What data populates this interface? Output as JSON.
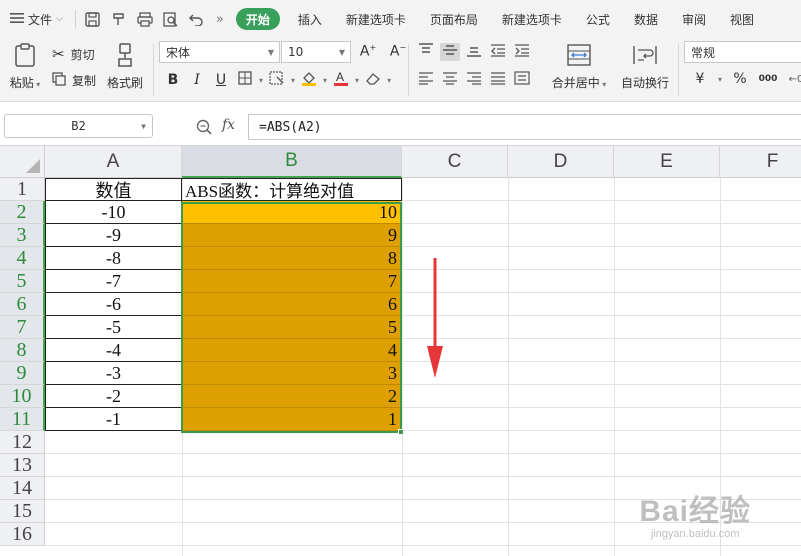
{
  "menubar": {
    "file_label": "文件",
    "tabs": [
      "开始",
      "插入",
      "新建选项卡",
      "页面布局",
      "新建选项卡",
      "公式",
      "数据",
      "审阅",
      "视图"
    ],
    "active_tab_index": 0
  },
  "ribbon": {
    "paste": "粘贴",
    "cut": "剪切",
    "copy": "复制",
    "format_painter": "格式刷",
    "font_name": "宋体",
    "font_size": "10",
    "merge_center": "合并居中",
    "wrap_text": "自动换行",
    "number_format": "常规",
    "currency_symbol": "¥",
    "percent_symbol": "%",
    "thousands_symbol": "000"
  },
  "formula_bar": {
    "cell_ref": "B2",
    "fx": "fx",
    "formula": "=ABS(A2)"
  },
  "sheet": {
    "columns": [
      "A",
      "B",
      "C",
      "D",
      "E",
      "F"
    ],
    "selected_column": "B",
    "row_numbers": [
      "1",
      "2",
      "3",
      "4",
      "5",
      "6",
      "7",
      "8",
      "9",
      "10",
      "11",
      "12",
      "13",
      "14",
      "15",
      "16"
    ],
    "header": {
      "a": "数值",
      "b": "ABS函数：计算绝对值"
    },
    "rows": [
      {
        "a": "-10",
        "b": "10"
      },
      {
        "a": "-9",
        "b": "9"
      },
      {
        "a": "-8",
        "b": "8"
      },
      {
        "a": "-7",
        "b": "7"
      },
      {
        "a": "-6",
        "b": "6"
      },
      {
        "a": "-5",
        "b": "5"
      },
      {
        "a": "-4",
        "b": "4"
      },
      {
        "a": "-3",
        "b": "3"
      },
      {
        "a": "-2",
        "b": "2"
      },
      {
        "a": "-1",
        "b": "1"
      }
    ]
  },
  "colors": {
    "accent_green": "#38a05a",
    "cell_fill": "#dda000",
    "active_cell_fill": "#ffc000",
    "arrow_red": "#e8353a"
  },
  "watermark": {
    "brand": "Bai经验",
    "url": "jingyan.baidu.com"
  }
}
